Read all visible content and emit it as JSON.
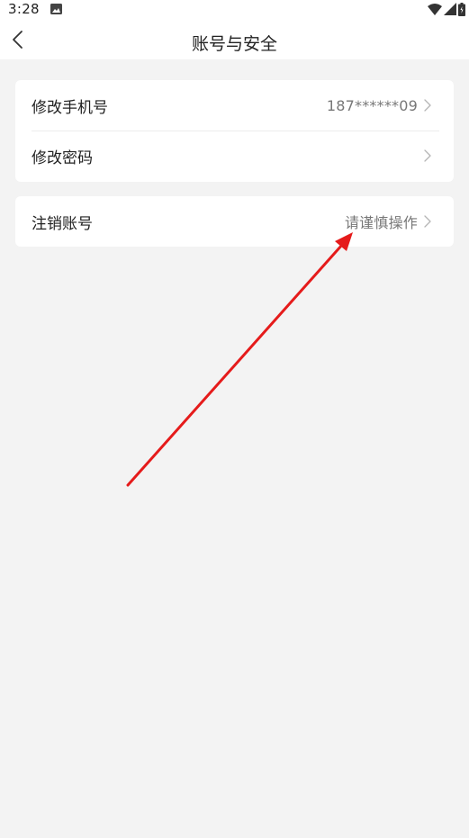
{
  "status_bar": {
    "time": "3:28",
    "icons": [
      "image-icon",
      "wifi-icon",
      "signal-icon",
      "battery-icon"
    ]
  },
  "nav": {
    "title": "账号与安全",
    "back_icon": "chevron-left-icon"
  },
  "settings": {
    "group1": [
      {
        "label": "修改手机号",
        "value": "187******09"
      },
      {
        "label": "修改密码",
        "value": ""
      }
    ],
    "group2": [
      {
        "label": "注销账号",
        "value": "请谨慎操作"
      }
    ]
  },
  "annotation": {
    "type": "red-arrow",
    "color": "#e51b1b",
    "points_to": "注销账号"
  },
  "colors": {
    "background": "#f3f3f3",
    "card": "#ffffff",
    "text": "#222222",
    "secondary_text": "#777777",
    "chevron": "#b5b5b5"
  }
}
